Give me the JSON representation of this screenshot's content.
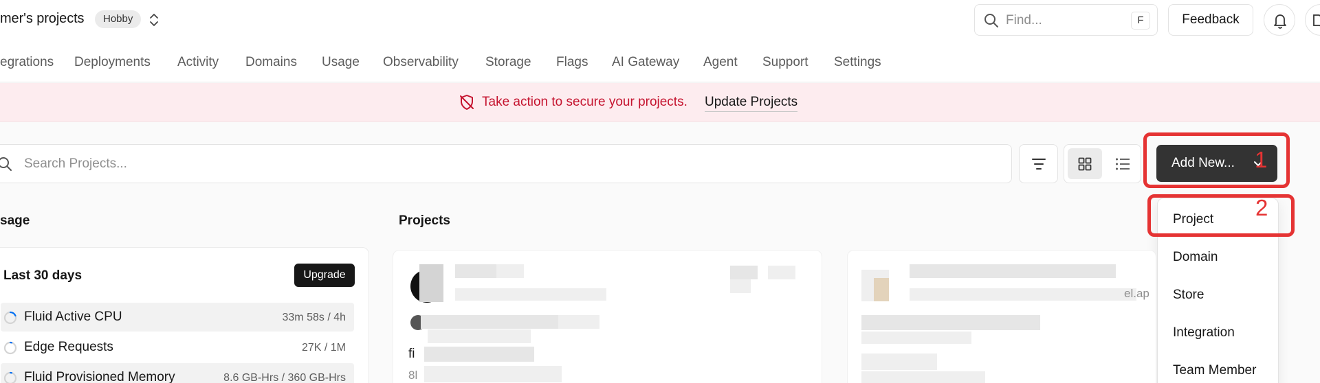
{
  "header": {
    "team_name": "mer's projects",
    "plan_badge": "Hobby",
    "find_placeholder": "Find...",
    "find_shortcut": "F",
    "feedback_label": "Feedback"
  },
  "nav": {
    "tabs": [
      "egrations",
      "Deployments",
      "Activity",
      "Domains",
      "Usage",
      "Observability",
      "Storage",
      "Flags",
      "AI Gateway",
      "Agent",
      "Support",
      "Settings"
    ]
  },
  "banner": {
    "message": "Take action to secure your projects.",
    "link": "Update Projects"
  },
  "toolbar": {
    "search_placeholder": "Search Projects...",
    "add_new_label": "Add New..."
  },
  "dropdown": {
    "items": [
      "Project",
      "Domain",
      "Store",
      "Integration",
      "Team Member"
    ]
  },
  "annotations": [
    "1",
    "2"
  ],
  "usage": {
    "section_title": "sage",
    "period": "Last 30 days",
    "upgrade_label": "Upgrade",
    "rows": [
      {
        "name": "Fluid Active CPU",
        "value": "33m 58s / 4h"
      },
      {
        "name": "Edge Requests",
        "value": "27K / 1M"
      },
      {
        "name": "Fluid Provisioned Memory",
        "value": "8.6 GB-Hrs / 360 GB-Hrs"
      }
    ]
  },
  "projects": {
    "section_title": "Projects",
    "card1_frag_1": "fi",
    "card1_frag_2": "8l",
    "card2_frag": "el.ap"
  },
  "colors": {
    "accent_dark": "#333333",
    "banner_bg": "#fdecef",
    "banner_text": "#c5142f",
    "annotation_red": "#e53333"
  }
}
